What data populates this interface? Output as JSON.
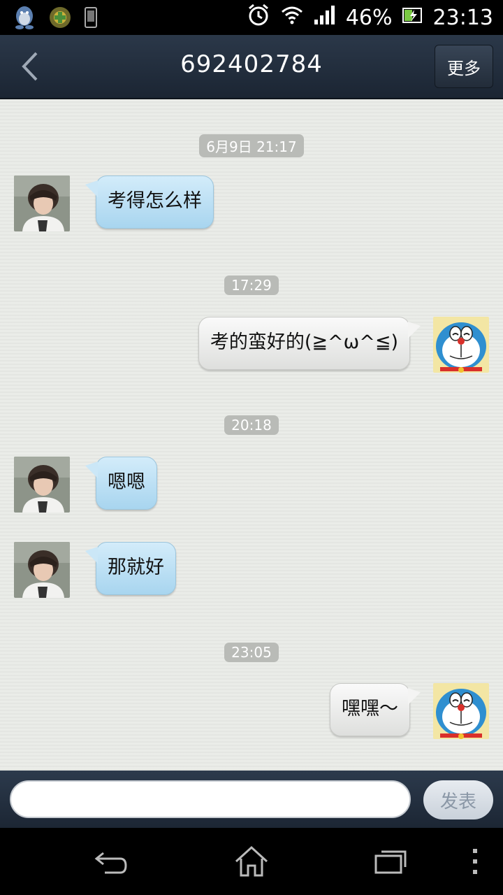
{
  "status_bar": {
    "battery": "46%",
    "time": "23:13",
    "icons": [
      "qq-penguin-icon",
      "app-badge-icon",
      "phone-icon",
      "alarm-icon",
      "wifi-icon",
      "signal-icon",
      "battery-charging-icon"
    ]
  },
  "header": {
    "title": "692402784",
    "more_label": "更多",
    "back_icon": "back-chevron-icon"
  },
  "messages": [
    {
      "timestamp": "6月9日 21:17"
    },
    {
      "sender": "contact",
      "text": "考得怎么样"
    },
    {
      "timestamp": "17:29"
    },
    {
      "sender": "me",
      "text": "考的蛮好的(≧^ω^≦)"
    },
    {
      "timestamp": "20:18"
    },
    {
      "sender": "contact",
      "text": "嗯嗯"
    },
    {
      "sender": "contact",
      "text": "那就好"
    },
    {
      "timestamp": "23:05"
    },
    {
      "sender": "me",
      "text": "嘿嘿～"
    }
  ],
  "composer": {
    "input_value": "",
    "send_label": "发表"
  },
  "nav": {
    "icons": [
      "back-arrow-icon",
      "home-icon",
      "recent-apps-icon",
      "menu-dots-icon"
    ]
  },
  "colors": {
    "incoming_bubble": "#a8d5ef",
    "outgoing_bubble": "#e6e7e5",
    "header_bg": "#23303f",
    "chat_bg": "#e9ebe7"
  }
}
